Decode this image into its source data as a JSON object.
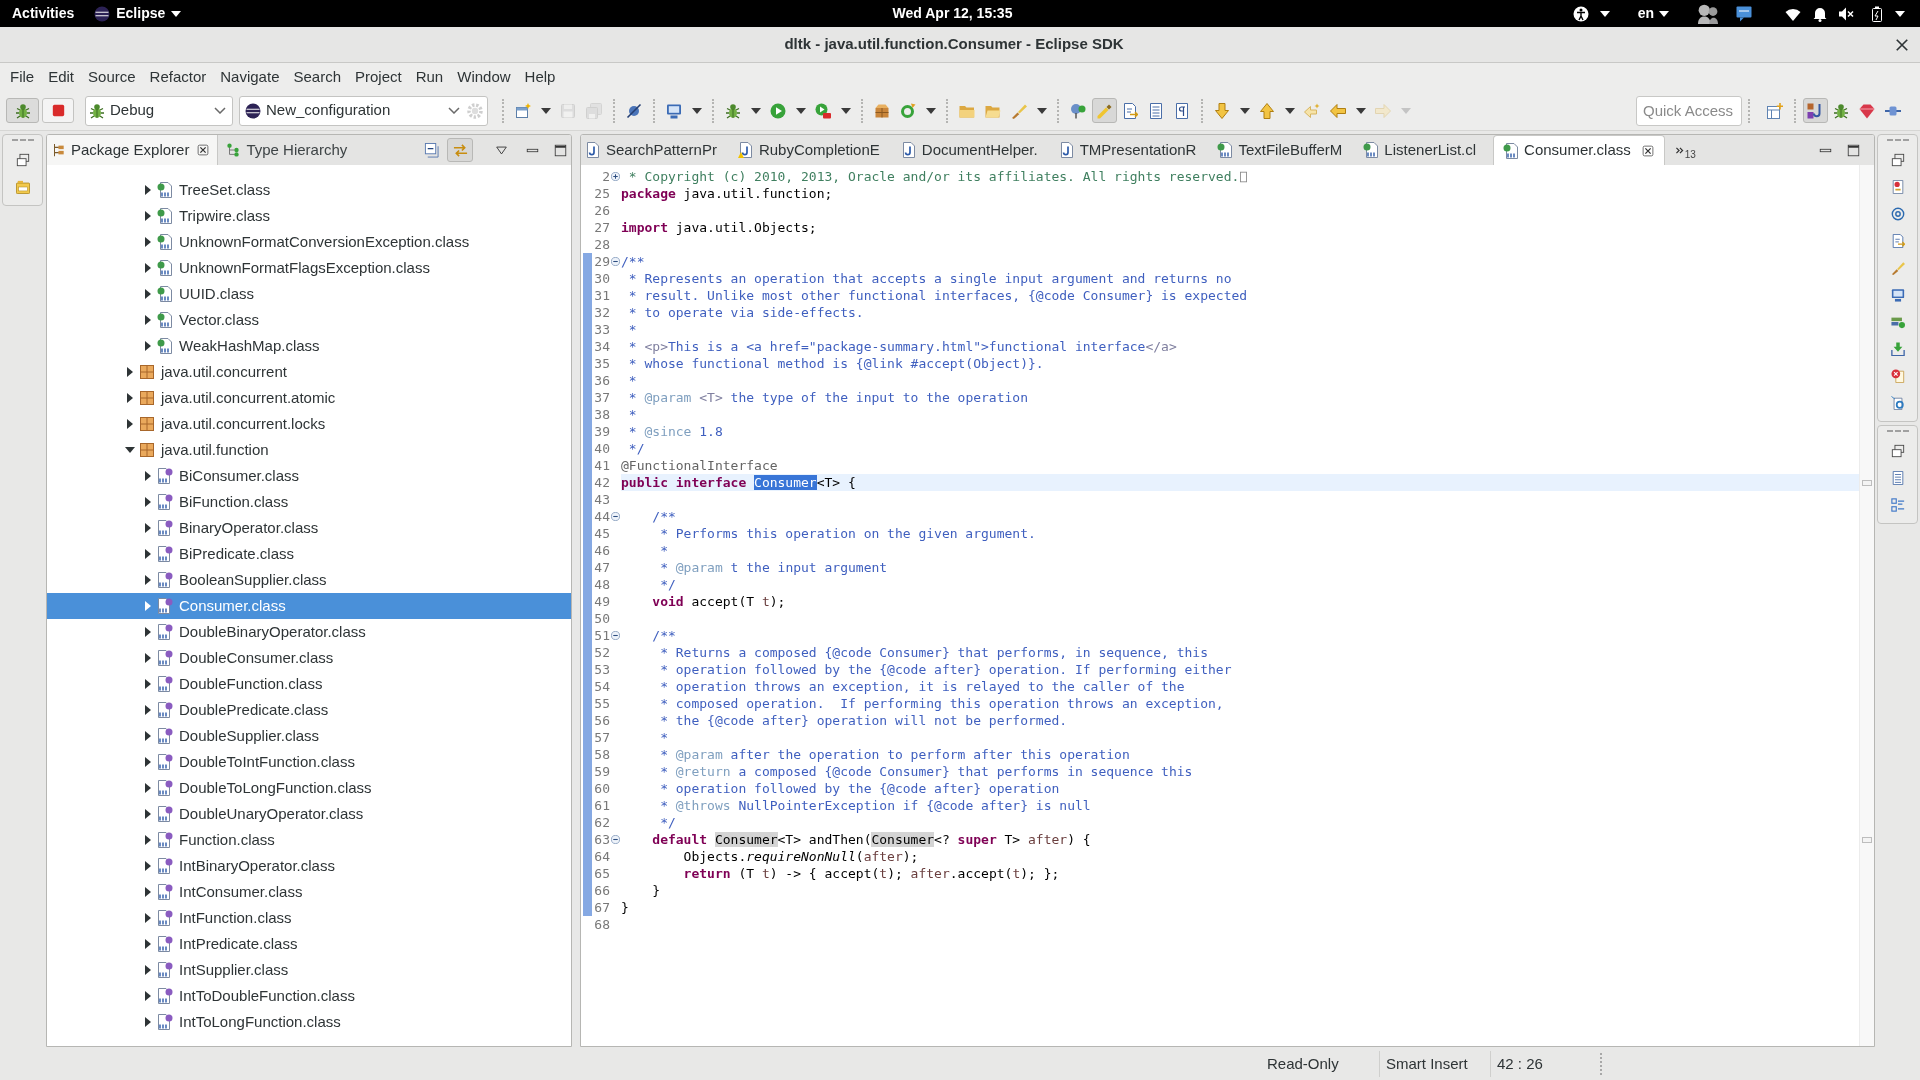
{
  "top_bar": {
    "activities": "Activities",
    "app_menu": "Eclipse",
    "clock": "Wed Apr 12, 15:35",
    "input_language": "en"
  },
  "window": {
    "title": "dltk - java.util.function.Consumer - Eclipse SDK"
  },
  "menu_bar": [
    "File",
    "Edit",
    "Source",
    "Refactor",
    "Navigate",
    "Search",
    "Project",
    "Run",
    "Window",
    "Help"
  ],
  "toolbar": {
    "launch_mode": "Debug",
    "launch_configuration": "New_configuration",
    "quick_access": {
      "placeholder": "Quick Access"
    }
  },
  "package_explorer": {
    "tabs": [
      {
        "label": "Package Explorer",
        "selected": true
      },
      {
        "label": "Type Hierarchy",
        "selected": false
      }
    ],
    "tree": [
      {
        "children": [
          {
            "label": "TreeSet.class",
            "kind": "class",
            "expanded": false,
            "selected": false
          },
          {
            "label": "Tripwire.class",
            "kind": "class",
            "expanded": false,
            "selected": false
          },
          {
            "label": "UnknownFormatConversionException.class",
            "kind": "class",
            "expanded": false,
            "selected": false
          },
          {
            "label": "UnknownFormatFlagsException.class",
            "kind": "class",
            "expanded": false,
            "selected": false
          },
          {
            "label": "UUID.class",
            "kind": "class",
            "expanded": false,
            "selected": false
          },
          {
            "label": "Vector.class",
            "kind": "class",
            "expanded": false,
            "selected": false
          },
          {
            "label": "WeakHashMap.class",
            "kind": "class",
            "expanded": false,
            "selected": false
          }
        ]
      },
      {
        "label": "java.util.concurrent",
        "kind": "package",
        "expanded": false,
        "selected": false
      },
      {
        "label": "java.util.concurrent.atomic",
        "kind": "package",
        "expanded": false,
        "selected": false
      },
      {
        "label": "java.util.concurrent.locks",
        "kind": "package",
        "expanded": false,
        "selected": false
      },
      {
        "label": "java.util.function",
        "kind": "package",
        "expanded": true,
        "selected": false,
        "children": [
          {
            "label": "BiConsumer.class",
            "kind": "interface",
            "expanded": false,
            "selected": false
          },
          {
            "label": "BiFunction.class",
            "kind": "interface",
            "expanded": false,
            "selected": false
          },
          {
            "label": "BinaryOperator.class",
            "kind": "interface",
            "expanded": false,
            "selected": false
          },
          {
            "label": "BiPredicate.class",
            "kind": "interface",
            "expanded": false,
            "selected": false
          },
          {
            "label": "BooleanSupplier.class",
            "kind": "interface",
            "expanded": false,
            "selected": false
          },
          {
            "label": "Consumer.class",
            "kind": "interface",
            "expanded": false,
            "selected": true
          },
          {
            "label": "DoubleBinaryOperator.class",
            "kind": "interface",
            "expanded": false,
            "selected": false
          },
          {
            "label": "DoubleConsumer.class",
            "kind": "interface",
            "expanded": false,
            "selected": false
          },
          {
            "label": "DoubleFunction.class",
            "kind": "interface",
            "expanded": false,
            "selected": false
          },
          {
            "label": "DoublePredicate.class",
            "kind": "interface",
            "expanded": false,
            "selected": false
          },
          {
            "label": "DoubleSupplier.class",
            "kind": "interface",
            "expanded": false,
            "selected": false
          },
          {
            "label": "DoubleToIntFunction.class",
            "kind": "interface",
            "expanded": false,
            "selected": false
          },
          {
            "label": "DoubleToLongFunction.class",
            "kind": "interface",
            "expanded": false,
            "selected": false
          },
          {
            "label": "DoubleUnaryOperator.class",
            "kind": "interface",
            "expanded": false,
            "selected": false
          },
          {
            "label": "Function.class",
            "kind": "interface",
            "expanded": false,
            "selected": false
          },
          {
            "label": "IntBinaryOperator.class",
            "kind": "interface",
            "expanded": false,
            "selected": false
          },
          {
            "label": "IntConsumer.class",
            "kind": "interface",
            "expanded": false,
            "selected": false
          },
          {
            "label": "IntFunction.class",
            "kind": "interface",
            "expanded": false,
            "selected": false
          },
          {
            "label": "IntPredicate.class",
            "kind": "interface",
            "expanded": false,
            "selected": false
          },
          {
            "label": "IntSupplier.class",
            "kind": "interface",
            "expanded": false,
            "selected": false
          },
          {
            "label": "IntToDoubleFunction.class",
            "kind": "interface",
            "expanded": false,
            "selected": false
          },
          {
            "label": "IntToLongFunction.class",
            "kind": "interface",
            "expanded": false,
            "selected": false
          }
        ]
      }
    ]
  },
  "editor": {
    "tabs": [
      {
        "label": "SearchPatternPr",
        "kind": "source",
        "selected": false
      },
      {
        "label": "RubyCompletionE",
        "kind": "source_warning",
        "selected": false
      },
      {
        "label": "DocumentHelper.",
        "kind": "source",
        "selected": false
      },
      {
        "label": "TMPresentationR",
        "kind": "source",
        "selected": false
      },
      {
        "label": "TextFileBufferM",
        "kind": "class",
        "selected": false
      },
      {
        "label": "ListenerList.cl",
        "kind": "class",
        "selected": false
      },
      {
        "label": "Consumer.class",
        "kind": "class",
        "selected": true
      }
    ],
    "hidden_tab_count": "13",
    "lines": [
      {
        "number": "2",
        "expanded": false,
        "range": false,
        "current": false,
        "segments": [
          {
            "kind": "comment",
            "text": " * Copyright (c) 2010, 2013, Oracle and/or its affiliates. All rights reserved."
          }
        ]
      },
      {
        "number": "25",
        "range": false,
        "current": false,
        "segments": [
          {
            "kind": "keyword",
            "text": "package"
          },
          {
            "kind": "plain",
            "text": " java.util.function;"
          }
        ]
      },
      {
        "number": "26",
        "range": false,
        "current": false
      },
      {
        "number": "27",
        "range": false,
        "current": false,
        "segments": [
          {
            "kind": "keyword",
            "text": "import"
          },
          {
            "kind": "plain",
            "text": " java.util.Objects;"
          }
        ]
      },
      {
        "number": "28",
        "range": false,
        "current": false
      },
      {
        "number": "29",
        "expanded": true,
        "range": true,
        "current": false,
        "segments": [
          {
            "kind": "javadoc",
            "text": "/**"
          }
        ]
      },
      {
        "number": "30",
        "range": true,
        "current": false,
        "segments": [
          {
            "kind": "javadoc",
            "text": " * Represents an operation that accepts a single input argument and returns no"
          }
        ]
      },
      {
        "number": "31",
        "range": true,
        "current": false,
        "segments": [
          {
            "kind": "javadoc",
            "text": " * result. Unlike most other functional interfaces, {@code Consumer} is expected"
          }
        ]
      },
      {
        "number": "32",
        "range": true,
        "current": false,
        "segments": [
          {
            "kind": "javadoc",
            "text": " * to operate via side-effects."
          }
        ]
      },
      {
        "number": "33",
        "range": true,
        "current": false,
        "segments": [
          {
            "kind": "javadoc",
            "text": " *"
          }
        ]
      },
      {
        "number": "34",
        "range": true,
        "current": false,
        "segments": [
          {
            "kind": "javadoc",
            "text": " * "
          },
          {
            "kind": "html",
            "text": "<p>"
          },
          {
            "kind": "javadoc",
            "text": "This is a <a href=\"package-summary.html\">functional interface"
          },
          {
            "kind": "html",
            "text": "</a>"
          }
        ]
      },
      {
        "number": "35",
        "range": true,
        "current": false,
        "segments": [
          {
            "kind": "javadoc",
            "text": " * whose functional method is {@link #accept(Object)}."
          }
        ]
      },
      {
        "number": "36",
        "range": true,
        "current": false,
        "segments": [
          {
            "kind": "javadoc",
            "text": " *"
          }
        ]
      },
      {
        "number": "37",
        "range": true,
        "current": false,
        "segments": [
          {
            "kind": "javadoc",
            "text": " * "
          },
          {
            "kind": "doctag",
            "text": "@param "
          },
          {
            "kind": "html",
            "text": "<T>"
          },
          {
            "kind": "javadoc",
            "text": " the type of the input to the operation"
          }
        ]
      },
      {
        "number": "38",
        "range": true,
        "current": false,
        "segments": [
          {
            "kind": "javadoc",
            "text": " *"
          }
        ]
      },
      {
        "number": "39",
        "range": true,
        "current": false,
        "segments": [
          {
            "kind": "javadoc",
            "text": " * "
          },
          {
            "kind": "doctag",
            "text": "@since"
          },
          {
            "kind": "javadoc",
            "text": " 1.8"
          }
        ]
      },
      {
        "number": "40",
        "range": true,
        "current": false,
        "segments": [
          {
            "kind": "javadoc",
            "text": " */"
          }
        ]
      },
      {
        "number": "41",
        "range": true,
        "current": false,
        "segments": [
          {
            "kind": "annotation",
            "text": "@FunctionalInterface"
          }
        ]
      },
      {
        "number": "42",
        "range": true,
        "current": true,
        "segments": [
          {
            "kind": "keyword",
            "text": "public interface "
          },
          {
            "kind": "selection",
            "text": "Consumer"
          },
          {
            "kind": "plain",
            "text": "<T> {"
          }
        ]
      },
      {
        "number": "43",
        "range": true,
        "current": false
      },
      {
        "number": "44",
        "expanded": true,
        "range": true,
        "current": false,
        "segments": [
          {
            "kind": "javadoc",
            "text": "    /**"
          }
        ]
      },
      {
        "number": "45",
        "range": true,
        "current": false,
        "segments": [
          {
            "kind": "javadoc",
            "text": "     * Performs this operation on the given argument."
          }
        ]
      },
      {
        "number": "46",
        "range": true,
        "current": false,
        "segments": [
          {
            "kind": "javadoc",
            "text": "     *"
          }
        ]
      },
      {
        "number": "47",
        "range": true,
        "current": false,
        "segments": [
          {
            "kind": "javadoc",
            "text": "     * "
          },
          {
            "kind": "doctag",
            "text": "@param"
          },
          {
            "kind": "javadoc",
            "text": " t the input argument"
          }
        ]
      },
      {
        "number": "48",
        "range": true,
        "current": false,
        "segments": [
          {
            "kind": "javadoc",
            "text": "     */"
          }
        ]
      },
      {
        "number": "49",
        "range": true,
        "current": false,
        "segments": [
          {
            "kind": "keyword",
            "text": "    void"
          },
          {
            "kind": "plain",
            "text": " accept(T "
          },
          {
            "kind": "variable",
            "text": "t"
          },
          {
            "kind": "plain",
            "text": ");"
          }
        ]
      },
      {
        "number": "50",
        "range": true,
        "current": false
      },
      {
        "number": "51",
        "expanded": true,
        "range": true,
        "current": false,
        "segments": [
          {
            "kind": "javadoc",
            "text": "    /**"
          }
        ]
      },
      {
        "number": "52",
        "range": true,
        "current": false,
        "segments": [
          {
            "kind": "javadoc",
            "text": "     * Returns a composed {@code Consumer} that performs, in sequence, this"
          }
        ]
      },
      {
        "number": "53",
        "range": true,
        "current": false,
        "segments": [
          {
            "kind": "javadoc",
            "text": "     * operation followed by the {@code after} operation. If performing either"
          }
        ]
      },
      {
        "number": "54",
        "range": true,
        "current": false,
        "segments": [
          {
            "kind": "javadoc",
            "text": "     * operation throws an exception, it is relayed to the caller of the"
          }
        ]
      },
      {
        "number": "55",
        "range": true,
        "current": false,
        "segments": [
          {
            "kind": "javadoc",
            "text": "     * composed operation.  If performing this operation throws an exception,"
          }
        ]
      },
      {
        "number": "56",
        "range": true,
        "current": false,
        "segments": [
          {
            "kind": "javadoc",
            "text": "     * the {@code after} operation will not be performed."
          }
        ]
      },
      {
        "number": "57",
        "range": true,
        "current": false,
        "segments": [
          {
            "kind": "javadoc",
            "text": "     *"
          }
        ]
      },
      {
        "number": "58",
        "range": true,
        "current": false,
        "segments": [
          {
            "kind": "javadoc",
            "text": "     * "
          },
          {
            "kind": "doctag",
            "text": "@param"
          },
          {
            "kind": "javadoc",
            "text": " after the operation to perform after this operation"
          }
        ]
      },
      {
        "number": "59",
        "range": true,
        "current": false,
        "segments": [
          {
            "kind": "javadoc",
            "text": "     * "
          },
          {
            "kind": "doctag",
            "text": "@return"
          },
          {
            "kind": "javadoc",
            "text": " a composed {@code Consumer} that performs in sequence this"
          }
        ]
      },
      {
        "number": "60",
        "range": true,
        "current": false,
        "segments": [
          {
            "kind": "javadoc",
            "text": "     * operation followed by the {@code after} operation"
          }
        ]
      },
      {
        "number": "61",
        "range": true,
        "current": false,
        "segments": [
          {
            "kind": "javadoc",
            "text": "     * "
          },
          {
            "kind": "doctag",
            "text": "@throws"
          },
          {
            "kind": "javadoc",
            "text": " NullPointerException if {@code after} is null"
          }
        ]
      },
      {
        "number": "62",
        "range": true,
        "current": false,
        "segments": [
          {
            "kind": "javadoc",
            "text": "     */"
          }
        ]
      },
      {
        "number": "63",
        "expanded": true,
        "range": true,
        "current": false,
        "segments": [
          {
            "kind": "keyword",
            "text": "    default "
          },
          {
            "kind": "occurrence",
            "text": "Consumer"
          },
          {
            "kind": "plain",
            "text": "<T> andThen("
          },
          {
            "kind": "occurrence",
            "text": "Consumer"
          },
          {
            "kind": "plain",
            "text": "<? "
          },
          {
            "kind": "keyword",
            "text": "super"
          },
          {
            "kind": "plain",
            "text": " T> "
          },
          {
            "kind": "variable",
            "text": "after"
          },
          {
            "kind": "plain",
            "text": ") {"
          }
        ]
      },
      {
        "number": "64",
        "range": true,
        "current": false,
        "segments": [
          {
            "kind": "plain",
            "text": "        Objects."
          },
          {
            "kind": "static_call",
            "text": "requireNonNull"
          },
          {
            "kind": "plain",
            "text": "("
          },
          {
            "kind": "variable",
            "text": "after"
          },
          {
            "kind": "plain",
            "text": ");"
          }
        ]
      },
      {
        "number": "65",
        "range": true,
        "current": false,
        "segments": [
          {
            "kind": "keyword",
            "text": "        return"
          },
          {
            "kind": "plain",
            "text": " (T "
          },
          {
            "kind": "variable",
            "text": "t"
          },
          {
            "kind": "plain",
            "text": ") -> { accept("
          },
          {
            "kind": "variable",
            "text": "t"
          },
          {
            "kind": "plain",
            "text": "); "
          },
          {
            "kind": "variable",
            "text": "after"
          },
          {
            "kind": "plain",
            "text": ".accept("
          },
          {
            "kind": "variable",
            "text": "t"
          },
          {
            "kind": "plain",
            "text": "); };"
          }
        ]
      },
      {
        "number": "66",
        "range": true,
        "current": false,
        "segments": [
          {
            "kind": "plain",
            "text": "    }"
          }
        ]
      },
      {
        "number": "67",
        "range": true,
        "current": false,
        "segments": [
          {
            "kind": "plain",
            "text": "}"
          }
        ]
      },
      {
        "number": "68",
        "range": false,
        "current": false
      }
    ]
  },
  "status_bar": {
    "write_mode": "Read-Only",
    "insert_mode": "Smart Insert",
    "cursor_position": "42 : 26"
  }
}
